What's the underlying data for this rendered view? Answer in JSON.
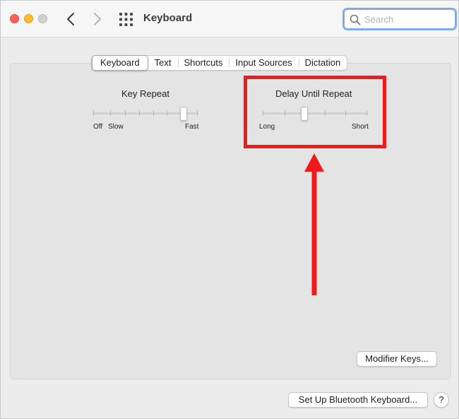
{
  "window": {
    "title": "Keyboard",
    "search_placeholder": "Search"
  },
  "tabs": [
    {
      "label": "Keyboard",
      "active": true
    },
    {
      "label": "Text",
      "active": false
    },
    {
      "label": "Shortcuts",
      "active": false
    },
    {
      "label": "Input Sources",
      "active": false
    },
    {
      "label": "Dictation",
      "active": false
    }
  ],
  "key_repeat": {
    "title": "Key Repeat",
    "label_off": "Off",
    "label_slow": "Slow",
    "label_fast": "Fast",
    "level_fraction": 0.86
  },
  "delay_until_repeat": {
    "title": "Delay Until Repeat",
    "label_long": "Long",
    "label_short": "Short",
    "level_fraction": 0.4
  },
  "buttons": {
    "modifier_keys": "Modifier Keys...",
    "bluetooth_keyboard": "Set Up Bluetooth Keyboard...",
    "help": "?"
  },
  "annotation": {
    "highlight_color": "#f11a1a"
  },
  "colors": {
    "close": "#fe5f57",
    "minimize": "#febc2e",
    "zoom_disabled": "#d0d0d0",
    "search_focus": "#7fa9ea"
  }
}
